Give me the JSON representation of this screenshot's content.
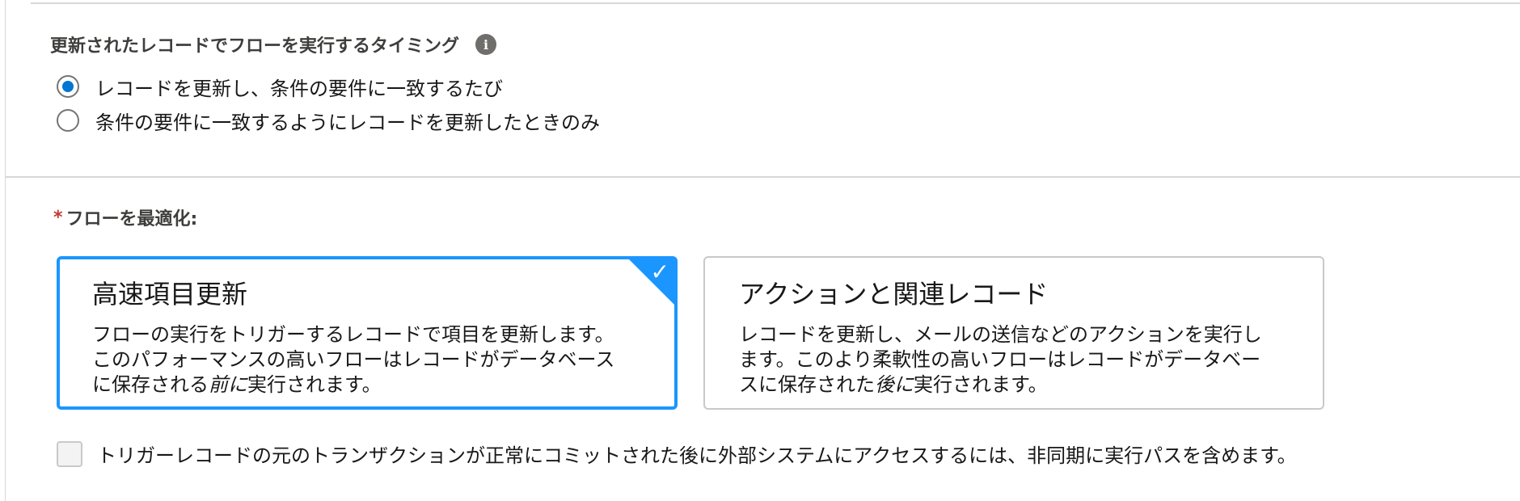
{
  "run_timing": {
    "legend": "更新されたレコードでフローを実行するタイミング",
    "options": [
      {
        "label": "レコードを更新し、条件の要件に一致するたび",
        "selected": true
      },
      {
        "label": "条件の要件に一致するようにレコードを更新したときのみ",
        "selected": false
      }
    ]
  },
  "optimize": {
    "required_marker": "*",
    "label": "フローを最適化:",
    "cards": [
      {
        "title": "高速項目更新",
        "body_before": "フローの実行をトリガーするレコードで項目を更新します。このパフォーマンスの高いフローはレコードがデータベースに保存される",
        "body_emphasis": "前に",
        "body_after": "実行されます。",
        "selected": true
      },
      {
        "title": "アクションと関連レコード",
        "body_before": "レコードを更新し、メールの送信などのアクションを実行します。このより柔軟性の高いフローはレコードがデータベースに保存された",
        "body_emphasis": "後に",
        "body_after": "実行されます。",
        "selected": false
      }
    ]
  },
  "async_option": {
    "label": "トリガーレコードの元のトランザクションが正常にコミットされた後に外部システムにアクセスするには、非同期に実行パスを含めます。",
    "checked": false,
    "disabled": true
  },
  "icons": {
    "info": "info-icon",
    "check": "checkmark-icon"
  },
  "colors": {
    "accent": "#1b96ff",
    "radio_selected": "#0176d3",
    "required": "#c23934"
  }
}
